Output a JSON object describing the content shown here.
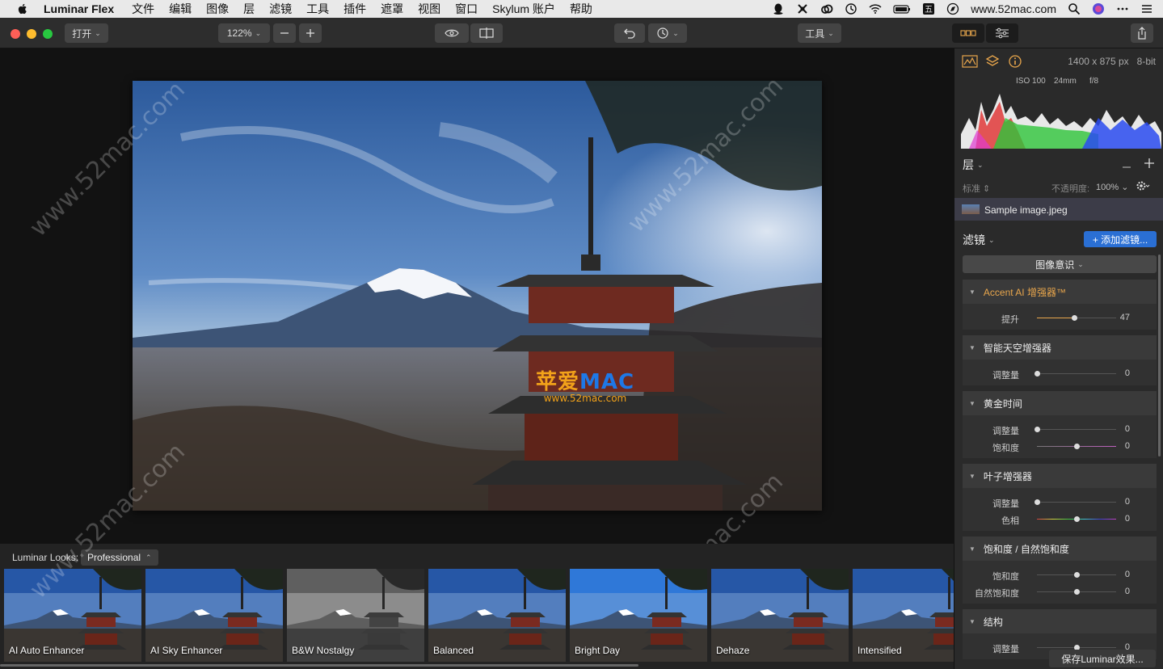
{
  "menubar": {
    "app_name": "Luminar Flex",
    "items": [
      "文件",
      "编辑",
      "图像",
      "层",
      "滤镜",
      "工具",
      "插件",
      "遮罩",
      "视图",
      "窗口",
      "Skylum 账户",
      "帮助"
    ],
    "status_url": "www.52mac.com"
  },
  "toolbar": {
    "open_label": "打开",
    "zoom_value": "122%",
    "tools_label": "工具"
  },
  "canvas": {
    "watermark_big_cn": "苹爱",
    "watermark_big_en": "MAC",
    "watermark_small": "www.52mac.com",
    "diag_watermark": "www.52mac.com"
  },
  "looks": {
    "label": "Luminar Looks:",
    "set": "Professional",
    "items": [
      {
        "name": "AI Auto Enhancer"
      },
      {
        "name": "AI Sky Enhancer"
      },
      {
        "name": "B&W Nostalgy"
      },
      {
        "name": "Balanced"
      },
      {
        "name": "Bright Day"
      },
      {
        "name": "Dehaze"
      },
      {
        "name": "Intensified"
      }
    ]
  },
  "panel": {
    "dimensions": "1400 x 875 px",
    "bit_depth": "8-bit",
    "exif": {
      "iso": "ISO 100",
      "focal": "24mm",
      "aperture": "f/8"
    },
    "layers_title": "层",
    "blend_mode": "标准",
    "opacity_label": "不透明度:",
    "opacity_value": "100%",
    "layer_name": "Sample image.jpeg",
    "filters_title": "滤镜",
    "add_filter": "+ 添加滤镜...",
    "ai_button": "图像意识",
    "filters": [
      {
        "title": "Accent AI 增强器™",
        "accent": true,
        "sliders": [
          {
            "label": "提升",
            "value": "47",
            "pos": 0.47,
            "color": "accent"
          }
        ]
      },
      {
        "title": "智能天空增强器",
        "sliders": [
          {
            "label": "调整量",
            "value": "0",
            "pos": 0,
            "color": "plain"
          }
        ]
      },
      {
        "title": "黄金时间",
        "sliders": [
          {
            "label": "调整量",
            "value": "0",
            "pos": 0,
            "color": "plain"
          },
          {
            "label": "饱和度",
            "value": "0",
            "pos": 0.5,
            "color": "sat"
          }
        ]
      },
      {
        "title": "叶子增强器",
        "sliders": [
          {
            "label": "调整量",
            "value": "0",
            "pos": 0,
            "color": "plain"
          },
          {
            "label": "色相",
            "value": "0",
            "pos": 0.5,
            "color": "hue"
          }
        ]
      },
      {
        "title": "饱和度 / 自然饱和度",
        "sliders": [
          {
            "label": "饱和度",
            "value": "0",
            "pos": 0.5,
            "color": "plain"
          },
          {
            "label": "自然饱和度",
            "value": "0",
            "pos": 0.5,
            "color": "plain"
          }
        ]
      },
      {
        "title": "结构",
        "sliders": [
          {
            "label": "调整量",
            "value": "0",
            "pos": 0.5,
            "color": "plain"
          }
        ]
      }
    ],
    "save_button": "保存Luminar效果..."
  },
  "colors": {
    "accent": "#2a6fd4",
    "accent_orange": "#e8a64c"
  }
}
